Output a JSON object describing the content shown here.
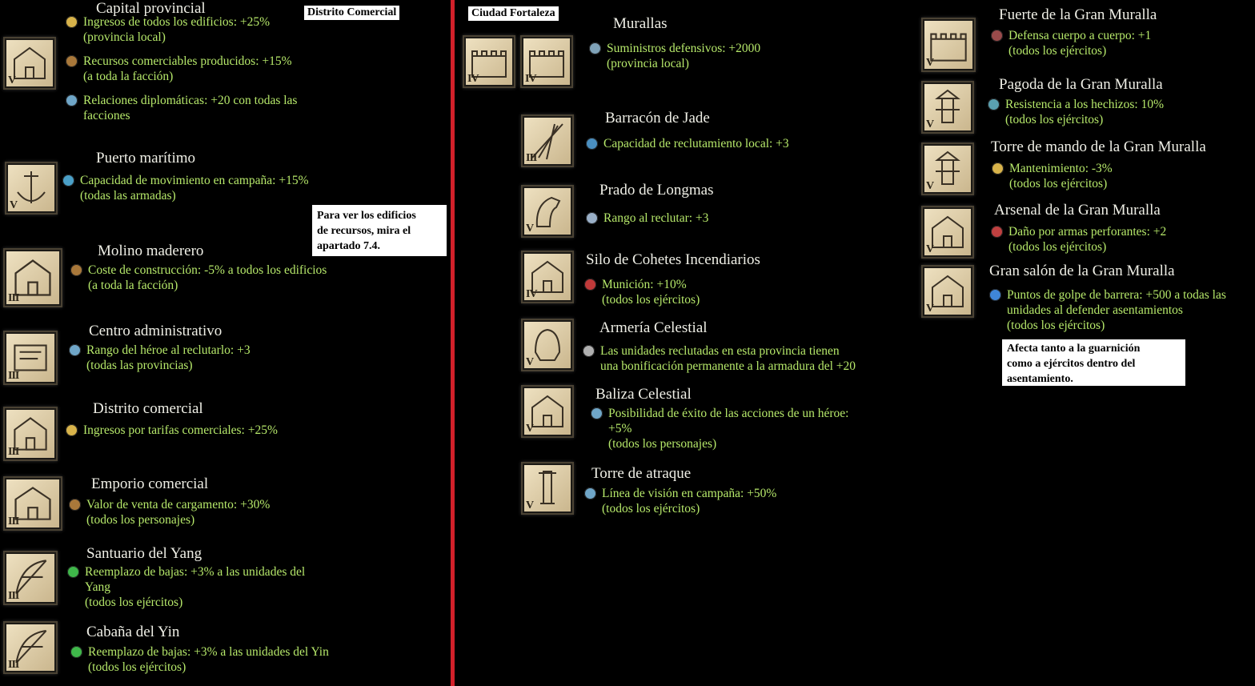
{
  "labels": {
    "distrito": "Distrito Comercial",
    "ciudad": "Ciudad Fortaleza"
  },
  "notes": {
    "recursos": [
      "Para ver los edificios",
      "de recursos, mira el",
      "apartado 7.4."
    ],
    "guarnicion": [
      "Afecta tanto a la guarnición",
      "como a ejércitos dentro del",
      "asentamiento."
    ]
  },
  "colors": {
    "effect_text": "#b6e86a",
    "title_text": "#efefe6",
    "divider": "#d2202a"
  },
  "left": [
    {
      "name": "Capital provincial",
      "tier": "V",
      "icon": "palace-icon",
      "effects": [
        {
          "icon": "coins-icon",
          "lines": [
            "Ingresos de todos los edificios: +25%",
            "(provincia local)"
          ]
        },
        {
          "icon": "chest-icon",
          "lines": [
            "Recursos comerciables producidos: +15%",
            "(a toda la facción)"
          ]
        },
        {
          "icon": "quill-icon",
          "lines": [
            "Relaciones diplomáticas: +20 con todas las",
            "facciones"
          ]
        }
      ]
    },
    {
      "name": "Puerto marítimo",
      "tier": "V",
      "icon": "anchor-icon",
      "effects": [
        {
          "icon": "compass-icon",
          "lines": [
            "Capacidad de movimiento en campaña: +15%",
            "(todas las armadas)"
          ]
        }
      ]
    },
    {
      "name": "Molino maderero",
      "tier": "III",
      "icon": "lumber-icon",
      "effects": [
        {
          "icon": "chest-icon",
          "lines": [
            "Coste de construcción: -5% a todos los edificios",
            "(a toda la facción)"
          ]
        }
      ]
    },
    {
      "name": "Centro administrativo",
      "tier": "III",
      "icon": "scroll-icon",
      "effects": [
        {
          "icon": "quill-icon",
          "lines": [
            "Rango del héroe al reclutarlo: +3",
            "(todas las provincias)"
          ]
        }
      ]
    },
    {
      "name": "Distrito comercial",
      "tier": "III",
      "icon": "market-icon",
      "effects": [
        {
          "icon": "coins-icon",
          "lines": [
            "Ingresos por tarifas comerciales: +25%"
          ]
        }
      ]
    },
    {
      "name": "Emporio comercial",
      "tier": "III",
      "icon": "emporium-icon",
      "effects": [
        {
          "icon": "chest-icon",
          "lines": [
            "Valor de venta de cargamento: +30%",
            "(todos los personajes)"
          ]
        }
      ]
    },
    {
      "name": "Santuario del Yang",
      "tier": "III",
      "icon": "bow-icon",
      "effects": [
        {
          "icon": "cross-icon",
          "lines": [
            "Reemplazo de bajas: +3% a las unidades del",
            "Yang",
            "(todos los ejércitos)"
          ]
        }
      ]
    },
    {
      "name": "Cabaña del Yin",
      "tier": "III",
      "icon": "bow-icon",
      "effects": [
        {
          "icon": "cross-icon",
          "lines": [
            "Reemplazo de bajas: +3% a las unidades del  Yin",
            "(todos los ejércitos)"
          ]
        }
      ]
    }
  ],
  "middle": [
    {
      "name": "Murallas",
      "tier": "IV",
      "icon": "walls-icon",
      "effects": [
        {
          "icon": "supplies-icon",
          "lines": [
            "Suministros defensivos: +2000",
            "(provincia local)"
          ]
        }
      ]
    },
    {
      "name": "Barracón de Jade",
      "tier": "III",
      "icon": "spears-icon",
      "effects": [
        {
          "icon": "recruit-icon",
          "lines": [
            "Capacidad de reclutamiento local: +3"
          ]
        }
      ]
    },
    {
      "name": "Prado de Longmas",
      "tier": "V",
      "icon": "horse-icon",
      "effects": [
        {
          "icon": "rank-icon",
          "lines": [
            "Rango al reclutar: +3"
          ]
        }
      ]
    },
    {
      "name": "Silo de Cohetes Incendiarios",
      "tier": "IV",
      "icon": "rocket-icon",
      "effects": [
        {
          "icon": "ammo-icon",
          "lines": [
            "Munición: +10%",
            "(todos los ejércitos)"
          ]
        }
      ]
    },
    {
      "name": "Armería Celestial",
      "tier": "V",
      "icon": "helmet-icon",
      "effects": [
        {
          "icon": "armor-icon",
          "lines": [
            "Las unidades reclutadas en esta provincia tienen",
            "una bonificación permanente a la armadura del +20"
          ]
        }
      ]
    },
    {
      "name": "Baliza Celestial",
      "tier": "V",
      "icon": "beacon-icon",
      "effects": [
        {
          "icon": "quill-icon",
          "lines": [
            "Posibilidad de éxito de las acciones de un héroe:",
            "+5%",
            "(todos los personajes)"
          ]
        }
      ]
    },
    {
      "name": "Torre de atraque",
      "tier": "V",
      "icon": "tower-icon",
      "effects": [
        {
          "icon": "quill-icon",
          "lines": [
            "Línea de visión en campaña: +50%",
            "(todos los ejércitos)"
          ]
        }
      ]
    }
  ],
  "right": [
    {
      "name": "Fuerte de la Gran Muralla",
      "tier": "V",
      "icon": "fort-icon",
      "effects": [
        {
          "icon": "shield-icon",
          "lines": [
            "Defensa cuerpo a cuerpo: +1",
            "(todos los ejércitos)"
          ]
        }
      ]
    },
    {
      "name": "Pagoda de la Gran Muralla",
      "tier": "V",
      "icon": "pagoda-icon",
      "effects": [
        {
          "icon": "ward-icon",
          "lines": [
            "Resistencia a los hechizos: 10%",
            "(todos los ejércitos)"
          ]
        }
      ]
    },
    {
      "name": "Torre de mando de la Gran Muralla",
      "tier": "V",
      "icon": "command-tower-icon",
      "effects": [
        {
          "icon": "coins-icon",
          "lines": [
            "Mantenimiento: -3%",
            "(todos los ejércitos)"
          ]
        }
      ]
    },
    {
      "name": "Arsenal de la Gran Muralla",
      "tier": "V",
      "icon": "arsenal-icon",
      "effects": [
        {
          "icon": "pierce-icon",
          "lines": [
            "Daño por armas perforantes: +2",
            "(todos los ejércitos)"
          ]
        }
      ]
    },
    {
      "name": "Gran salón de la   Gran Muralla",
      "tier": "V",
      "icon": "hall-icon",
      "effects": [
        {
          "icon": "barrier-icon",
          "lines": [
            "Puntos de golpe de barrera: +500 a todas las",
            "unidades al defender asentamientos",
            "(todos los ejércitos)"
          ]
        }
      ]
    }
  ]
}
